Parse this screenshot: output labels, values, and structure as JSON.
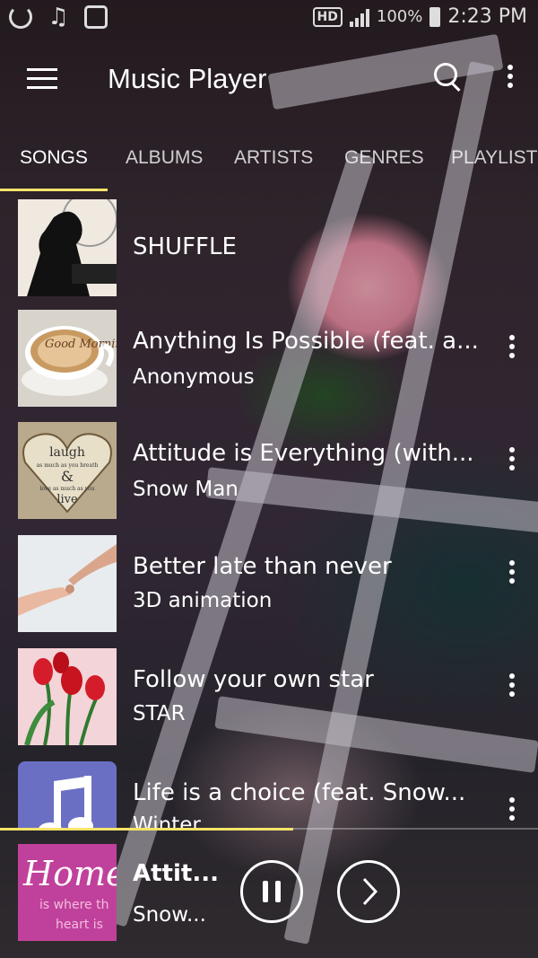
{
  "status_bar": {
    "hd": "HD",
    "battery": "100%",
    "time": "2:23 PM"
  },
  "app_bar": {
    "title": "Music Player"
  },
  "tabs": [
    "SONGS",
    "ALBUMS",
    "ARTISTS",
    "GENRES",
    "PLAYLISTS"
  ],
  "active_tab": "SONGS",
  "shuffle_label": "SHUFFLE",
  "songs": [
    {
      "title": "Anything Is Possible (feat. a...",
      "artist": "Anonymous"
    },
    {
      "title": "Attitude is Everything (with...",
      "artist": "Snow Man"
    },
    {
      "title": "Better late than never",
      "artist": "3D animation"
    },
    {
      "title": "Follow your own star",
      "artist": "STAR"
    },
    {
      "title": "Life is a choice (feat. Snow...",
      "artist": "Winter"
    }
  ],
  "artwork_text": {
    "good_morning": "Good Morning",
    "laugh": "laugh",
    "laugh_sub": "as much as you breath",
    "amp": "&",
    "love_sub": "love as much as you",
    "live": "live",
    "home": "Home",
    "home_sub1": "is where th",
    "home_sub2": "heart is"
  },
  "now_playing": {
    "title": "Attit...",
    "artist": "Snow...",
    "progress": 0.545
  },
  "colors": {
    "accent": "#f5e46a"
  }
}
